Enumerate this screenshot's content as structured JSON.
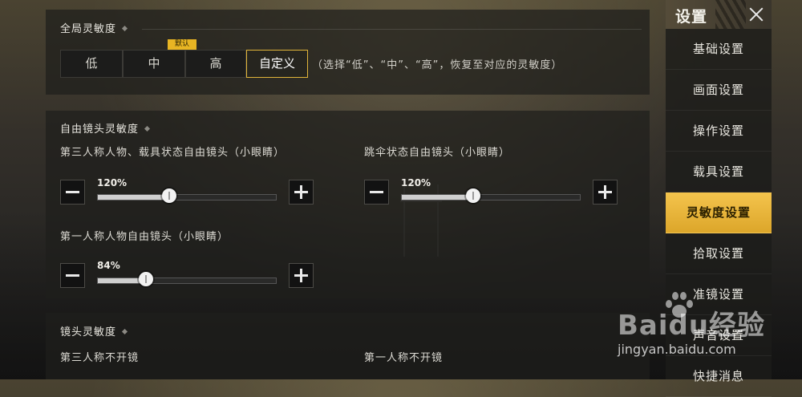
{
  "global": {
    "title": "全局灵敏度",
    "presets": [
      "低",
      "中",
      "高",
      "自定义"
    ],
    "active_index": 3,
    "default_tag": "默认",
    "hint": "（选择“低”、“中”、“高”，恢复至对应的灵敏度）"
  },
  "free_look": {
    "title": "自由镜头灵敏度",
    "sliders": [
      {
        "label": "第三人称人物、载具状态自由镜头（小眼睛）",
        "value": "120%",
        "fraction": 0.4
      },
      {
        "label": "跳伞状态自由镜头（小眼睛）",
        "value": "120%",
        "fraction": 0.4
      },
      {
        "label": "第一人称人物自由镜头（小眼睛）",
        "value": "84%",
        "fraction": 0.27
      }
    ]
  },
  "camera": {
    "title": "镜头灵敏度",
    "left_label": "第三人称不开镜",
    "right_label": "第一人称不开镜"
  },
  "sidebar": {
    "title": "设置",
    "items": [
      "基础设置",
      "画面设置",
      "操作设置",
      "载具设置",
      "灵敏度设置",
      "拾取设置",
      "准镜设置",
      "声音设置",
      "快捷消息"
    ],
    "active_index": 4
  },
  "watermark": {
    "brand": "Baidu经验",
    "url": "jingyan.baidu.com"
  },
  "colors": {
    "accent": "#e0b43a",
    "active_nav": "#f4c44d"
  }
}
